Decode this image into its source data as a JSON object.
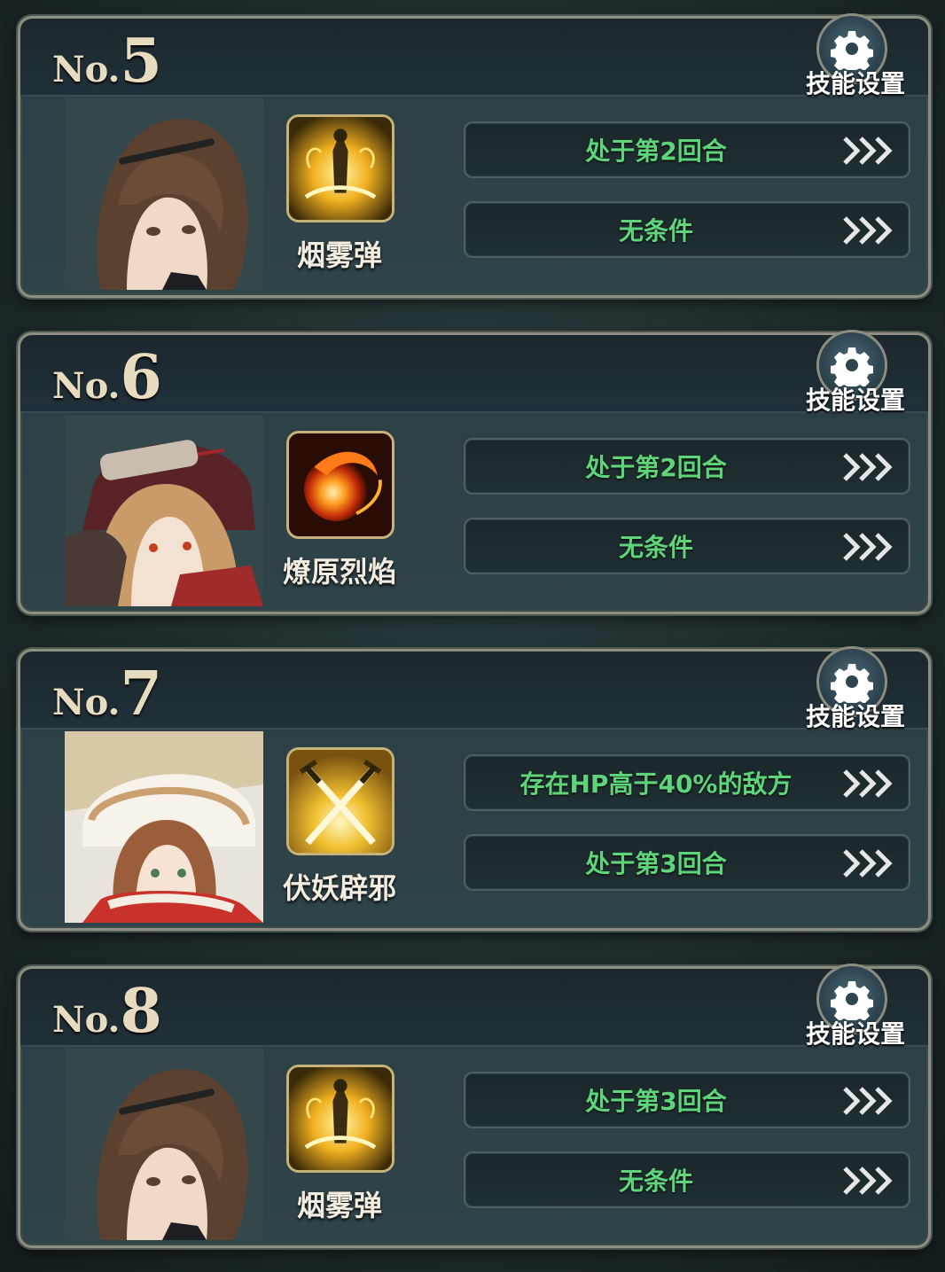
{
  "cards": [
    {
      "no_prefix": "No.",
      "number": "5",
      "settings_label": "技能设置",
      "skill_name": "烟雾弹",
      "skill_icon": "smoke-bomb-icon",
      "character": "brown-hair-girl",
      "conditions": [
        "处于第2回合",
        "无条件"
      ]
    },
    {
      "no_prefix": "No.",
      "number": "6",
      "settings_label": "技能设置",
      "skill_name": "燎原烈焰",
      "skill_icon": "fireball-icon",
      "character": "red-hood-girl",
      "conditions": [
        "处于第2回合",
        "无条件"
      ]
    },
    {
      "no_prefix": "No.",
      "number": "7",
      "settings_label": "技能设置",
      "skill_name": "伏妖辟邪",
      "skill_icon": "crossed-swords-icon",
      "character": "winter-hood-girl",
      "conditions": [
        "存在HP高于40%的敌方",
        "处于第3回合"
      ]
    },
    {
      "no_prefix": "No.",
      "number": "8",
      "settings_label": "技能设置",
      "skill_name": "烟雾弹",
      "skill_icon": "smoke-bomb-icon",
      "character": "brown-hair-girl",
      "conditions": [
        "处于第3回合",
        "无条件"
      ]
    }
  ],
  "colors": {
    "condition_text": "#5fd47a",
    "number_text": "#e8dcc0",
    "frame": "#8d8f82"
  }
}
